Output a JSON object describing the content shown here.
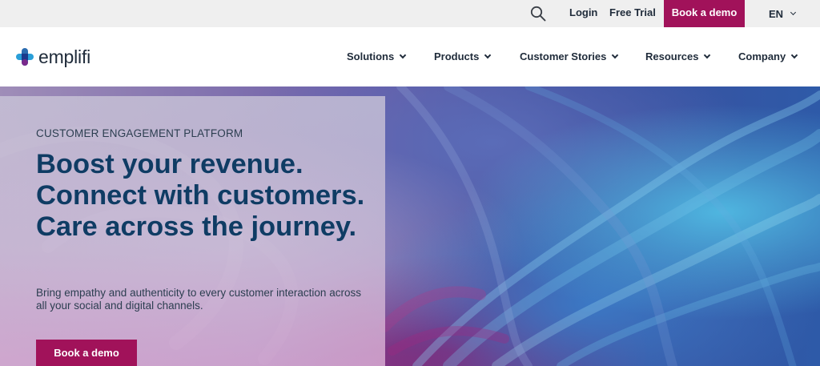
{
  "utility_bar": {
    "search_icon": "search-icon",
    "login_label": "Login",
    "free_trial_label": "Free Trial",
    "book_demo_label": "Book a demo",
    "language_label": "EN"
  },
  "nav": {
    "logo_text": "emplifi",
    "items": [
      {
        "label": "Solutions"
      },
      {
        "label": "Products"
      },
      {
        "label": "Customer Stories"
      },
      {
        "label": "Resources"
      },
      {
        "label": "Company"
      }
    ]
  },
  "hero": {
    "eyebrow": "CUSTOMER ENGAGEMENT PLATFORM",
    "headline": "Boost your revenue. Connect with customers. Care across the journey.",
    "subtext": "Bring empathy and authenticity to every customer interaction across all your social and digital channels.",
    "cta_label": "Book a demo"
  },
  "colors": {
    "brand": "#a1125a",
    "headline": "#0f3c64",
    "utility_bg": "#efefef"
  }
}
